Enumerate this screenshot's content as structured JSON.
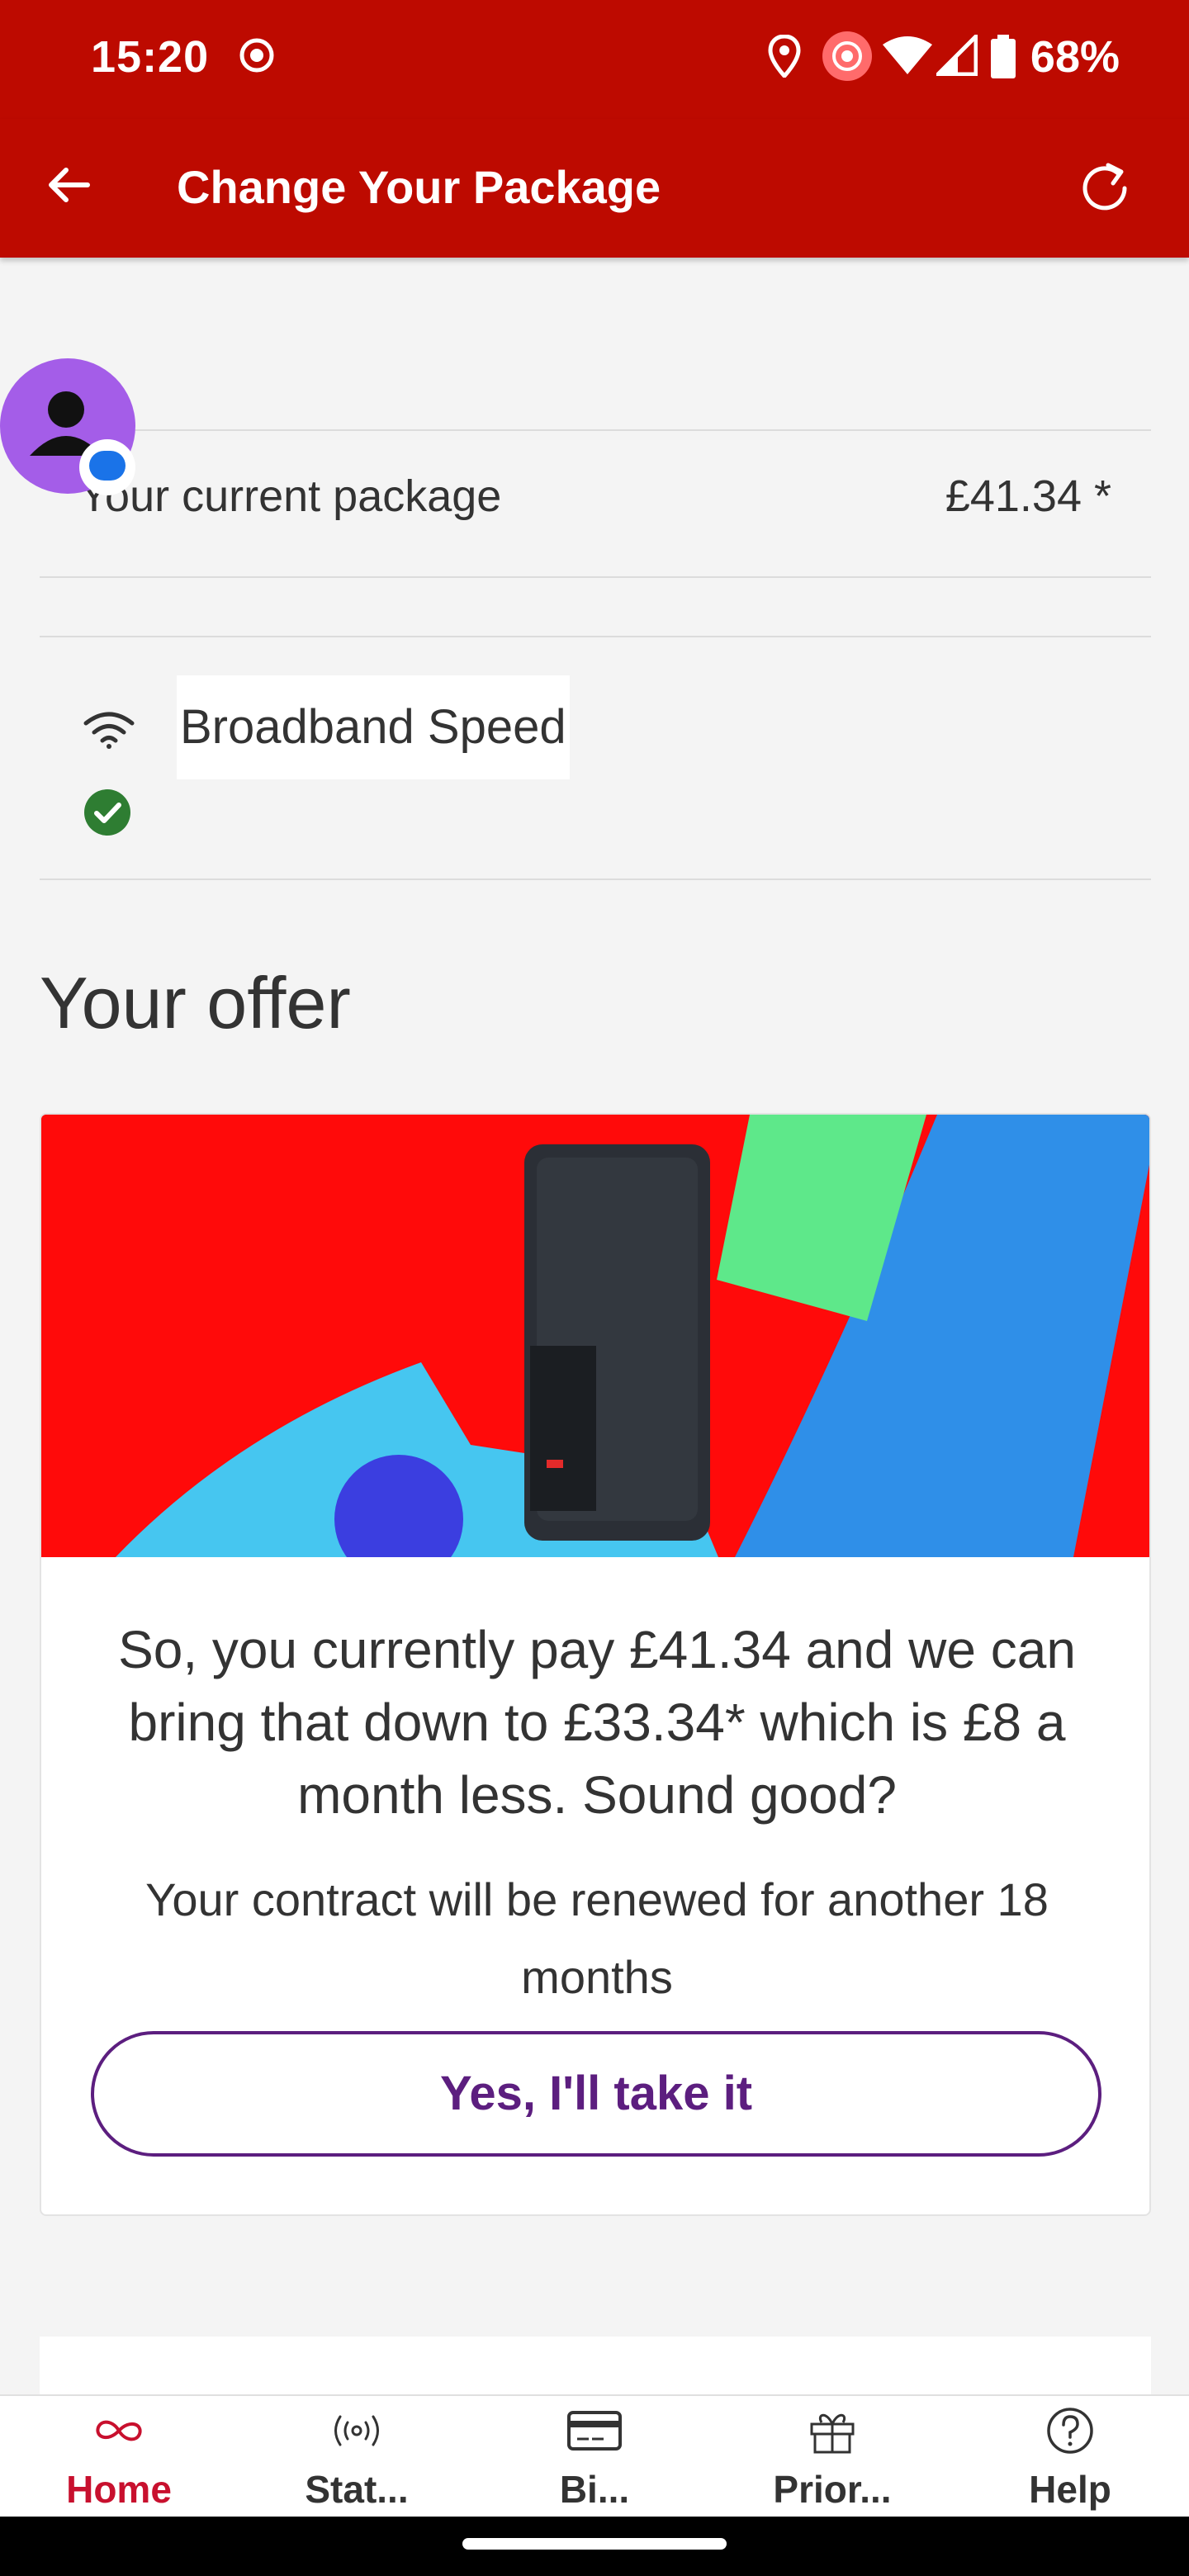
{
  "status_bar": {
    "time": "15:20",
    "battery": "68%",
    "icons": [
      "screen-record-icon",
      "location-icon",
      "cast-icon",
      "wifi-icon",
      "signal-icon",
      "battery-icon"
    ]
  },
  "app_bar": {
    "title": "Change Your Package",
    "back_icon": "arrow-back-icon",
    "refresh_icon": "refresh-icon",
    "background": "#bd0a00"
  },
  "current_package": {
    "label": "Your current package",
    "price": "£41.34 *"
  },
  "features": [
    {
      "label": "Broadband Speed",
      "icon": "wifi-icon",
      "status_icon": "check-circle-icon"
    }
  ],
  "offer": {
    "heading": "Your offer",
    "main_text": "So, you currently pay £41.34 and we can bring that down to £33.34* which is £8 a month less. Sound good?",
    "sub_text": "Your contract will be renewed for another 18 months",
    "cta_label": "Yes, I'll take it",
    "cta_color": "#5c1e7f"
  },
  "bottom_nav": {
    "items": [
      {
        "label": "Home",
        "icon": "infinity-icon",
        "active": true
      },
      {
        "label": "Stat...",
        "icon": "broadcast-icon",
        "active": false
      },
      {
        "label": "Bi...",
        "icon": "card-icon",
        "active": false
      },
      {
        "label": "Prior...",
        "icon": "gift-icon",
        "active": false
      },
      {
        "label": "Help",
        "icon": "help-icon",
        "active": false
      }
    ],
    "active_color": "#c8102e"
  }
}
